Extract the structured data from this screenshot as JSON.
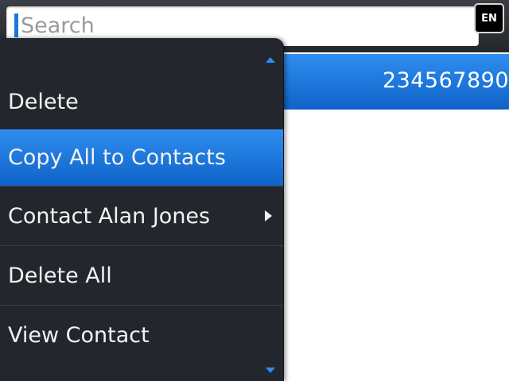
{
  "search": {
    "placeholder": "Search",
    "value": ""
  },
  "language": {
    "label": "EN"
  },
  "list": {
    "selected_row_text": "234567890"
  },
  "menu": {
    "items": [
      {
        "label": "Delete"
      },
      {
        "label": "Copy All to Contacts",
        "highlighted": true
      },
      {
        "label": "Contact Alan Jones",
        "has_submenu": true
      },
      {
        "label": "Delete All"
      },
      {
        "label": "View Contact"
      }
    ],
    "scroll_up_icon": "chevron-up-icon",
    "scroll_down_icon": "chevron-down-icon"
  },
  "colors": {
    "accent": "#1a78d8",
    "menu_background": "#23272d",
    "menu_text": "#f2f2f2"
  }
}
